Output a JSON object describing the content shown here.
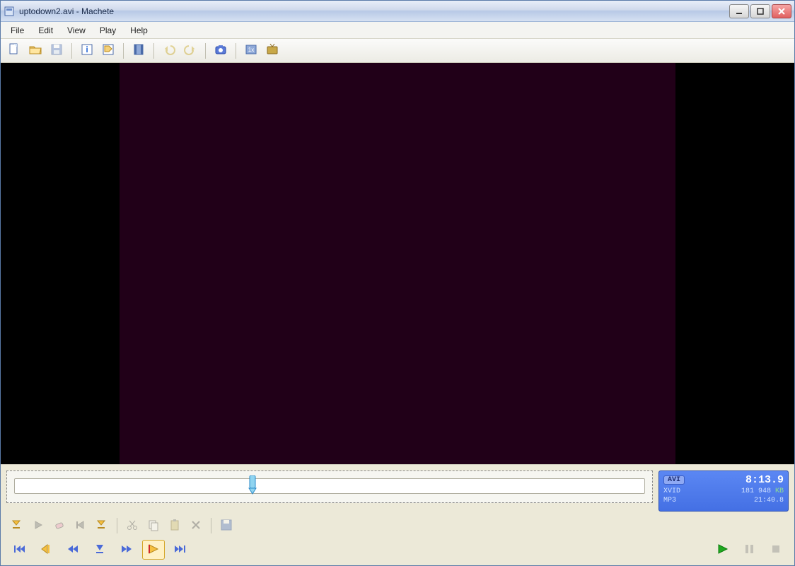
{
  "window": {
    "title": "uptodown2.avi - Machete"
  },
  "menu": [
    "File",
    "Edit",
    "View",
    "Play",
    "Help"
  ],
  "toolbar": [
    {
      "name": "new-icon"
    },
    {
      "name": "open-icon"
    },
    {
      "name": "save-icon",
      "disabled": true
    },
    {
      "sep": true
    },
    {
      "name": "info-icon"
    },
    {
      "name": "tags-icon"
    },
    {
      "sep": true
    },
    {
      "name": "film-icon"
    },
    {
      "sep": true
    },
    {
      "name": "undo-icon",
      "disabled": true
    },
    {
      "name": "redo-icon",
      "disabled": true
    },
    {
      "sep": true
    },
    {
      "name": "snapshot-icon"
    },
    {
      "sep": true
    },
    {
      "name": "zoom-1x-icon"
    },
    {
      "name": "tv-icon"
    }
  ],
  "timeline": {
    "position_percent": 38
  },
  "info": {
    "container": "AVI",
    "time": "8:13.9",
    "video_codec": "XVID",
    "size": "181 948",
    "size_unit": "KB",
    "audio_codec": "MP3",
    "duration": "21:40.8"
  },
  "edit_toolbar": [
    {
      "name": "mark-start-icon"
    },
    {
      "name": "play-selection-icon",
      "disabled": true
    },
    {
      "name": "erase-icon",
      "disabled": true
    },
    {
      "name": "jump-back-icon",
      "disabled": true
    },
    {
      "name": "mark-end-icon"
    },
    {
      "sep": true
    },
    {
      "name": "cut-icon",
      "disabled": true
    },
    {
      "name": "copy-icon",
      "disabled": true
    },
    {
      "name": "paste-icon",
      "disabled": true
    },
    {
      "name": "delete-icon",
      "disabled": true
    },
    {
      "sep": true
    },
    {
      "name": "save-selection-icon",
      "disabled": true
    }
  ],
  "play_toolbar_left": [
    {
      "name": "skip-start-icon"
    },
    {
      "name": "prev-keyframe-icon"
    },
    {
      "name": "rewind-icon"
    },
    {
      "name": "step-back-icon"
    },
    {
      "name": "fast-forward-icon"
    },
    {
      "name": "next-keyframe-icon",
      "active": true
    },
    {
      "name": "skip-end-icon"
    }
  ],
  "play_toolbar_right": [
    {
      "name": "play-icon"
    },
    {
      "name": "pause-icon",
      "disabled": true
    },
    {
      "name": "stop-icon",
      "disabled": true
    }
  ]
}
